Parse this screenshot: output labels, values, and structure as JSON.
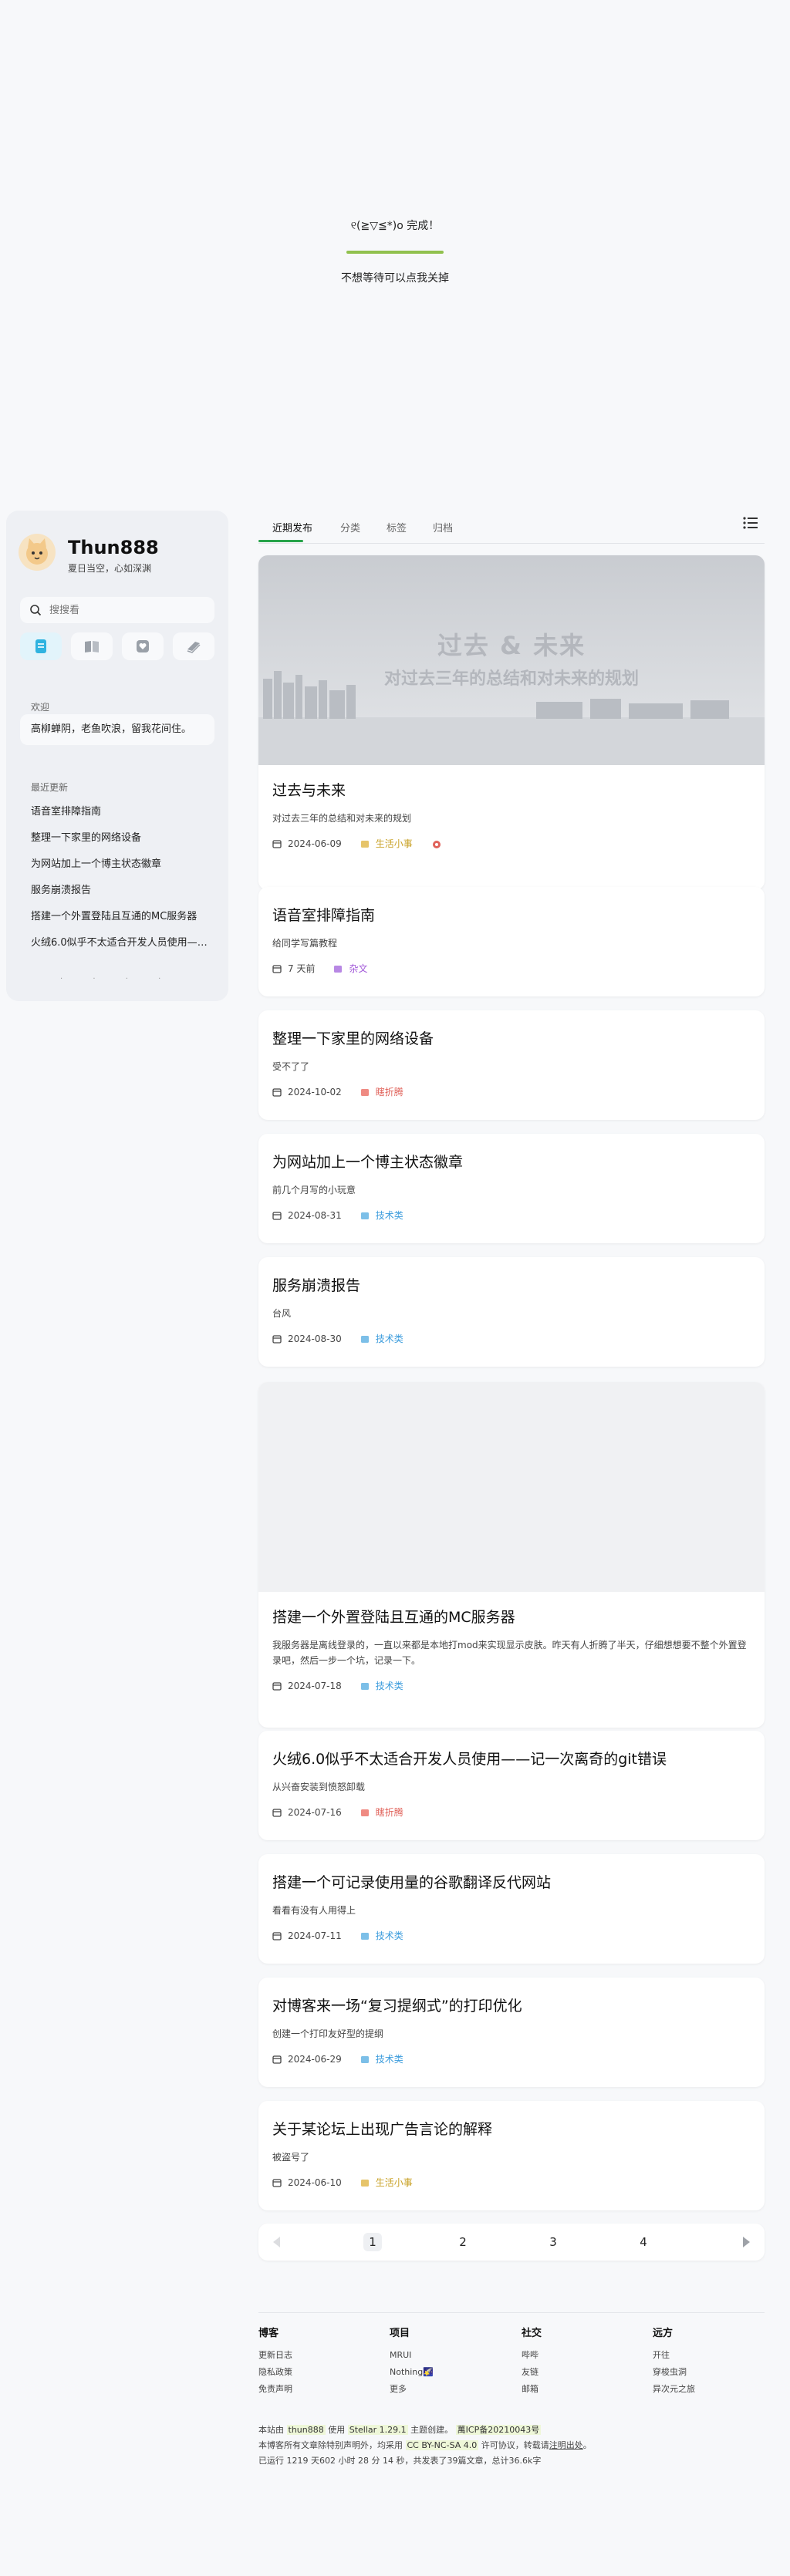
{
  "loader": {
    "face": "୧(≧▽≦*)o 完成！",
    "progress": 1.0,
    "skip_text": "不想等待可以点我关掉",
    "bar_color": "#91c14e"
  },
  "sidebar": {
    "site_name": "Thun888",
    "tagline": "夏日当空，心如深渊",
    "search_placeholder": "搜搜看",
    "nav_icons": [
      "blog-icon",
      "wiki-icon",
      "friends-icon",
      "notes-icon"
    ],
    "welcome_title": "欢迎",
    "welcome_text": "高柳蝉阴，老鱼吹浪，留我花间住。",
    "recent_title": "最近更新",
    "recent_items": [
      "语音室排障指南",
      "整理一下家里的网络设备",
      "为网站加上一个博主状态徽章",
      "服务崩溃报告",
      "搭建一个外置登陆且互通的MC服务器",
      "火绒6.0似乎不太适合开发人员使用——记一次离奇的git错误"
    ]
  },
  "tabs": {
    "items": [
      "近期发布",
      "分类",
      "标签",
      "归档"
    ],
    "active": 0,
    "accent": "#27a34a"
  },
  "cover_banner": {
    "line1": "过去 & 未来",
    "line2": "对过去三年的总结和对未来的规划"
  },
  "posts": [
    {
      "title": "过去与未来",
      "excerpt": "对过去三年的总结和对未来的规划",
      "date": "2024-06-09",
      "category": "生活小事",
      "cat_color": "#c9a227"
    },
    {
      "title": "语音室排障指南",
      "excerpt": "给同学写篇教程",
      "date": "7 天前",
      "category": "杂文",
      "cat_color": "#a259d9"
    },
    {
      "title": "整理一下家里的网络设备",
      "excerpt": "受不了了",
      "date": "2024-10-02",
      "category": "瞎折腾",
      "cat_color": "#e0625a"
    },
    {
      "title": "为网站加上一个博主状态徽章",
      "excerpt": "前几个月写的小玩意",
      "date": "2024-08-31",
      "category": "技术类",
      "cat_color": "#3a9bdc"
    },
    {
      "title": "服务崩溃报告",
      "excerpt": "台风",
      "date": "2024-08-30",
      "category": "技术类",
      "cat_color": "#3a9bdc"
    },
    {
      "title": "搭建一个外置登陆且互通的MC服务器",
      "excerpt": "我服务器是离线登录的，一直以来都是本地打mod来实现显示皮肤。昨天有人折腾了半天，仔细想想要不整个外置登录吧，然后一步一个坑，记录一下。",
      "date": "2024-07-18",
      "category": "技术类",
      "cat_color": "#3a9bdc"
    },
    {
      "title": "火绒6.0似乎不太适合开发人员使用——记一次离奇的git错误",
      "excerpt": "从兴奋安装到愤怒卸载",
      "date": "2024-07-16",
      "category": "瞎折腾",
      "cat_color": "#e0625a"
    },
    {
      "title": "搭建一个可记录使用量的谷歌翻译反代网站",
      "excerpt": "看看有没有人用得上",
      "date": "2024-07-11",
      "category": "技术类",
      "cat_color": "#3a9bdc"
    },
    {
      "title": "对博客来一场“复习提纲式”的打印优化",
      "excerpt": "创建一个打印友好型的提纲",
      "date": "2024-06-29",
      "category": "技术类",
      "cat_color": "#3a9bdc"
    },
    {
      "title": "关于某论坛上出现广告言论的解释",
      "excerpt": "被盗号了",
      "date": "2024-06-10",
      "category": "生活小事",
      "cat_color": "#c9a227"
    }
  ],
  "pager": {
    "pages": [
      "1",
      "2",
      "3",
      "4"
    ],
    "current": 0
  },
  "footer": {
    "columns": [
      {
        "title": "博客",
        "links": [
          "更新日志",
          "隐私政策",
          "免责声明"
        ]
      },
      {
        "title": "项目",
        "links": [
          "MRUI",
          "Nothing🌠",
          "更多"
        ]
      },
      {
        "title": "社交",
        "links": [
          "哔哔",
          "友链",
          "邮箱"
        ]
      },
      {
        "title": "远方",
        "links": [
          "开往",
          "穿梭虫洞",
          "异次元之旅"
        ]
      }
    ],
    "line1_a": "本站由",
    "line1_owner": "thun888",
    "line1_b": "使用",
    "line1_theme": "Stellar 1.29.1",
    "line1_c": "主题创建。",
    "line1_icp": "萬ICP备20210043号",
    "line2_a": "本博客所有文章除特别声明外，均采用",
    "line2_license": "CC BY-NC-SA 4.0",
    "line2_b": "许可协议，转载请",
    "line2_cite": "注明出处",
    "line2_c": "。",
    "line3": "已运行 1219 天602 小时 28 分 14 秒，共发表了39篇文章，总计36.6k字"
  }
}
